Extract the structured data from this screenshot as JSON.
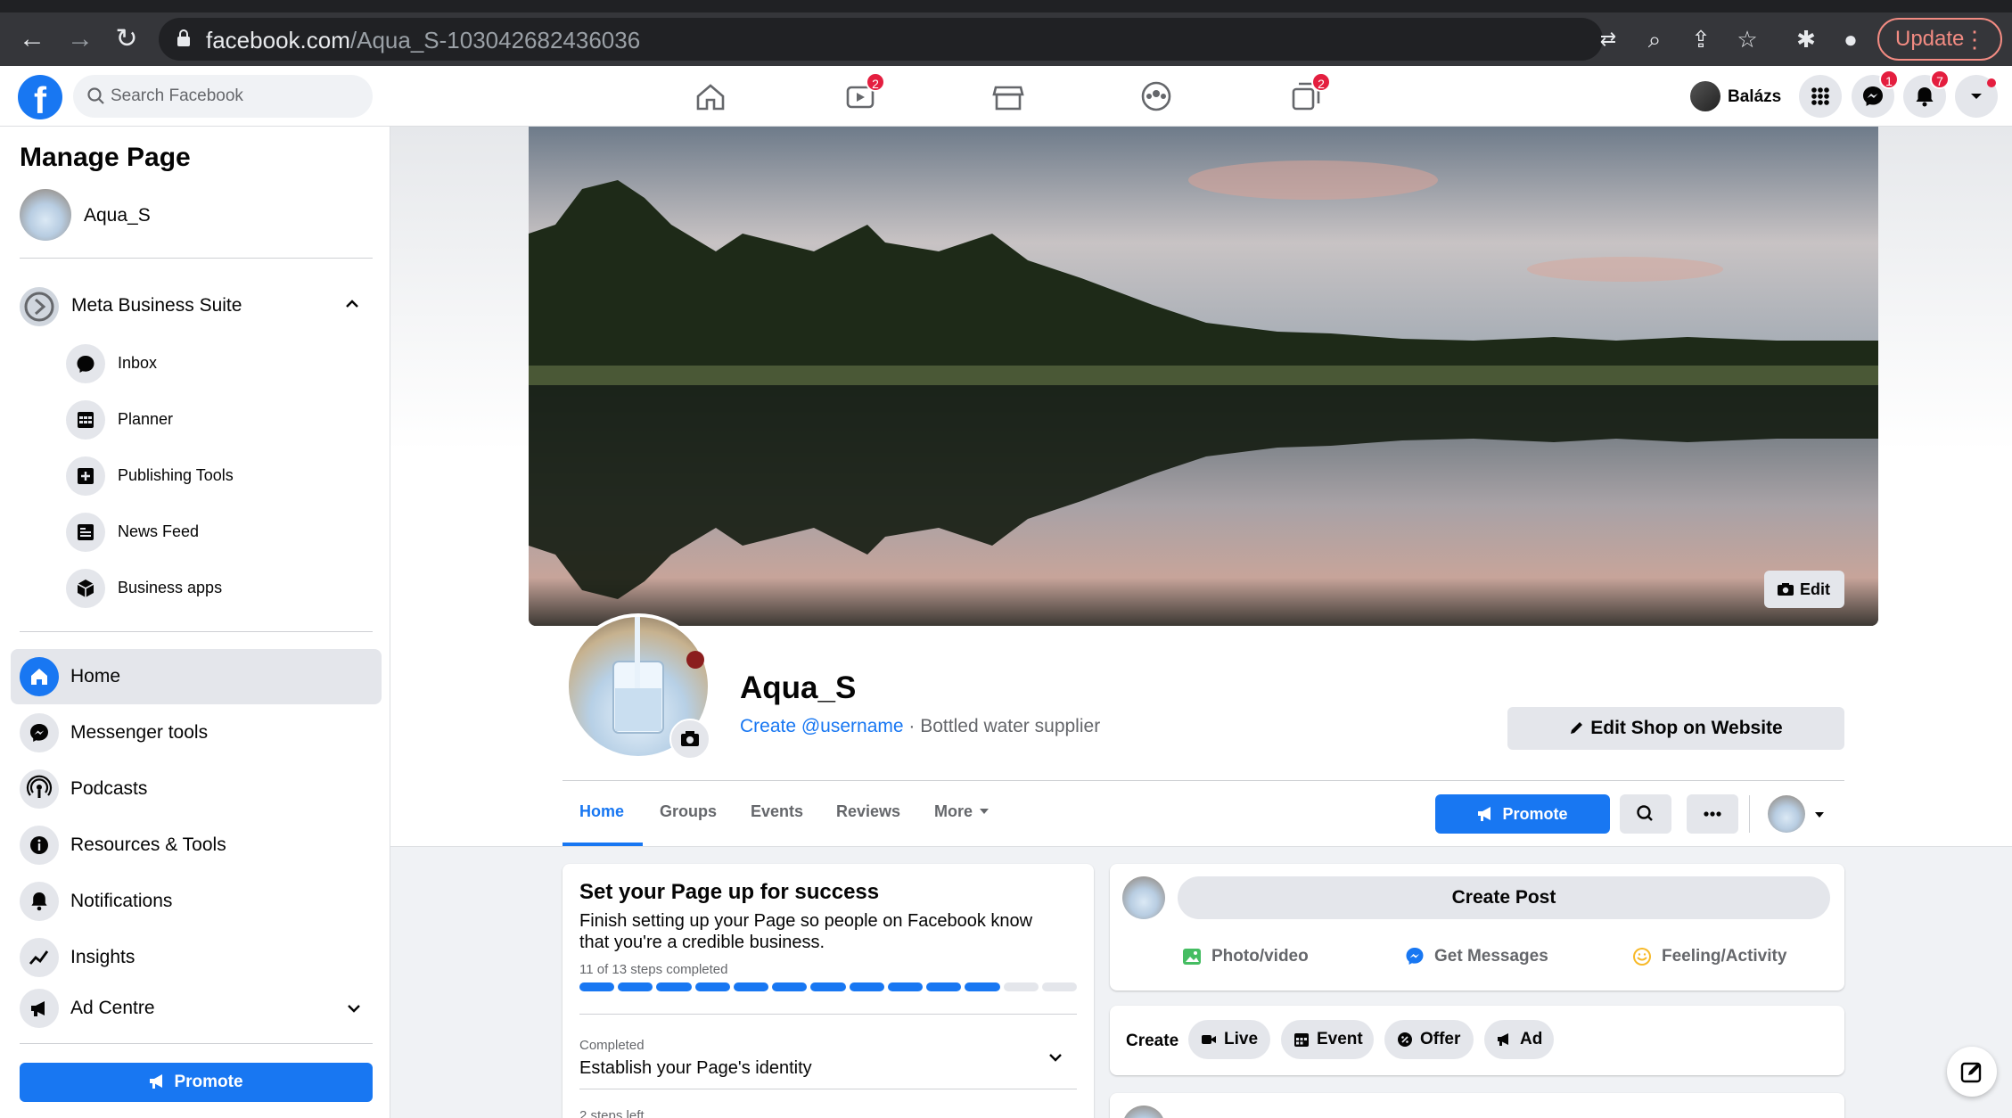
{
  "browser": {
    "url_domain": "facebook.com",
    "url_path": "/Aqua_S-103042682436036",
    "update_label": "Update"
  },
  "topbar": {
    "search_placeholder": "Search Facebook",
    "watch_badge": "2",
    "gaming_badge": "2",
    "user_name": "Balázs",
    "messenger_badge": "1",
    "notifications_badge": "7"
  },
  "sidebar": {
    "title": "Manage Page",
    "page_name": "Aqua_S",
    "business_suite_label": "Meta Business Suite",
    "suite_items": [
      {
        "label": "Inbox"
      },
      {
        "label": "Planner"
      },
      {
        "label": "Publishing Tools"
      },
      {
        "label": "News Feed"
      },
      {
        "label": "Business apps"
      }
    ],
    "items": [
      {
        "label": "Home"
      },
      {
        "label": "Messenger tools"
      },
      {
        "label": "Podcasts"
      },
      {
        "label": "Resources & Tools"
      },
      {
        "label": "Notifications"
      },
      {
        "label": "Insights"
      },
      {
        "label": "Ad Centre"
      }
    ],
    "promote_label": "Promote"
  },
  "profile": {
    "cover_edit_label": "Edit",
    "page_name": "Aqua_S",
    "username_link": "Create @username",
    "category": " · Bottled water supplier",
    "edit_shop_label": "Edit Shop on Website"
  },
  "tabs": [
    {
      "label": "Home"
    },
    {
      "label": "Groups"
    },
    {
      "label": "Events"
    },
    {
      "label": "Reviews"
    },
    {
      "label": "More"
    }
  ],
  "tab_promote_label": "Promote",
  "setup": {
    "title": "Set your Page up for success",
    "description": "Finish setting up your Page so people on Facebook know that you're a credible business.",
    "steps_text": "11 of 13 steps completed",
    "steps_completed": 11,
    "steps_total": 13,
    "completed_label": "Completed",
    "identity_label": "Establish your Page's identity",
    "steps_left": "2 steps left"
  },
  "create_post": {
    "button_label": "Create Post",
    "actions": [
      {
        "label": "Photo/video"
      },
      {
        "label": "Get Messages"
      },
      {
        "label": "Feeling/Activity"
      }
    ]
  },
  "create_row": {
    "label": "Create",
    "chips": [
      {
        "label": "Live"
      },
      {
        "label": "Event"
      },
      {
        "label": "Offer"
      },
      {
        "label": "Ad"
      }
    ]
  },
  "colors": {
    "brand": "#1877f2",
    "badge": "#e41e3f"
  }
}
